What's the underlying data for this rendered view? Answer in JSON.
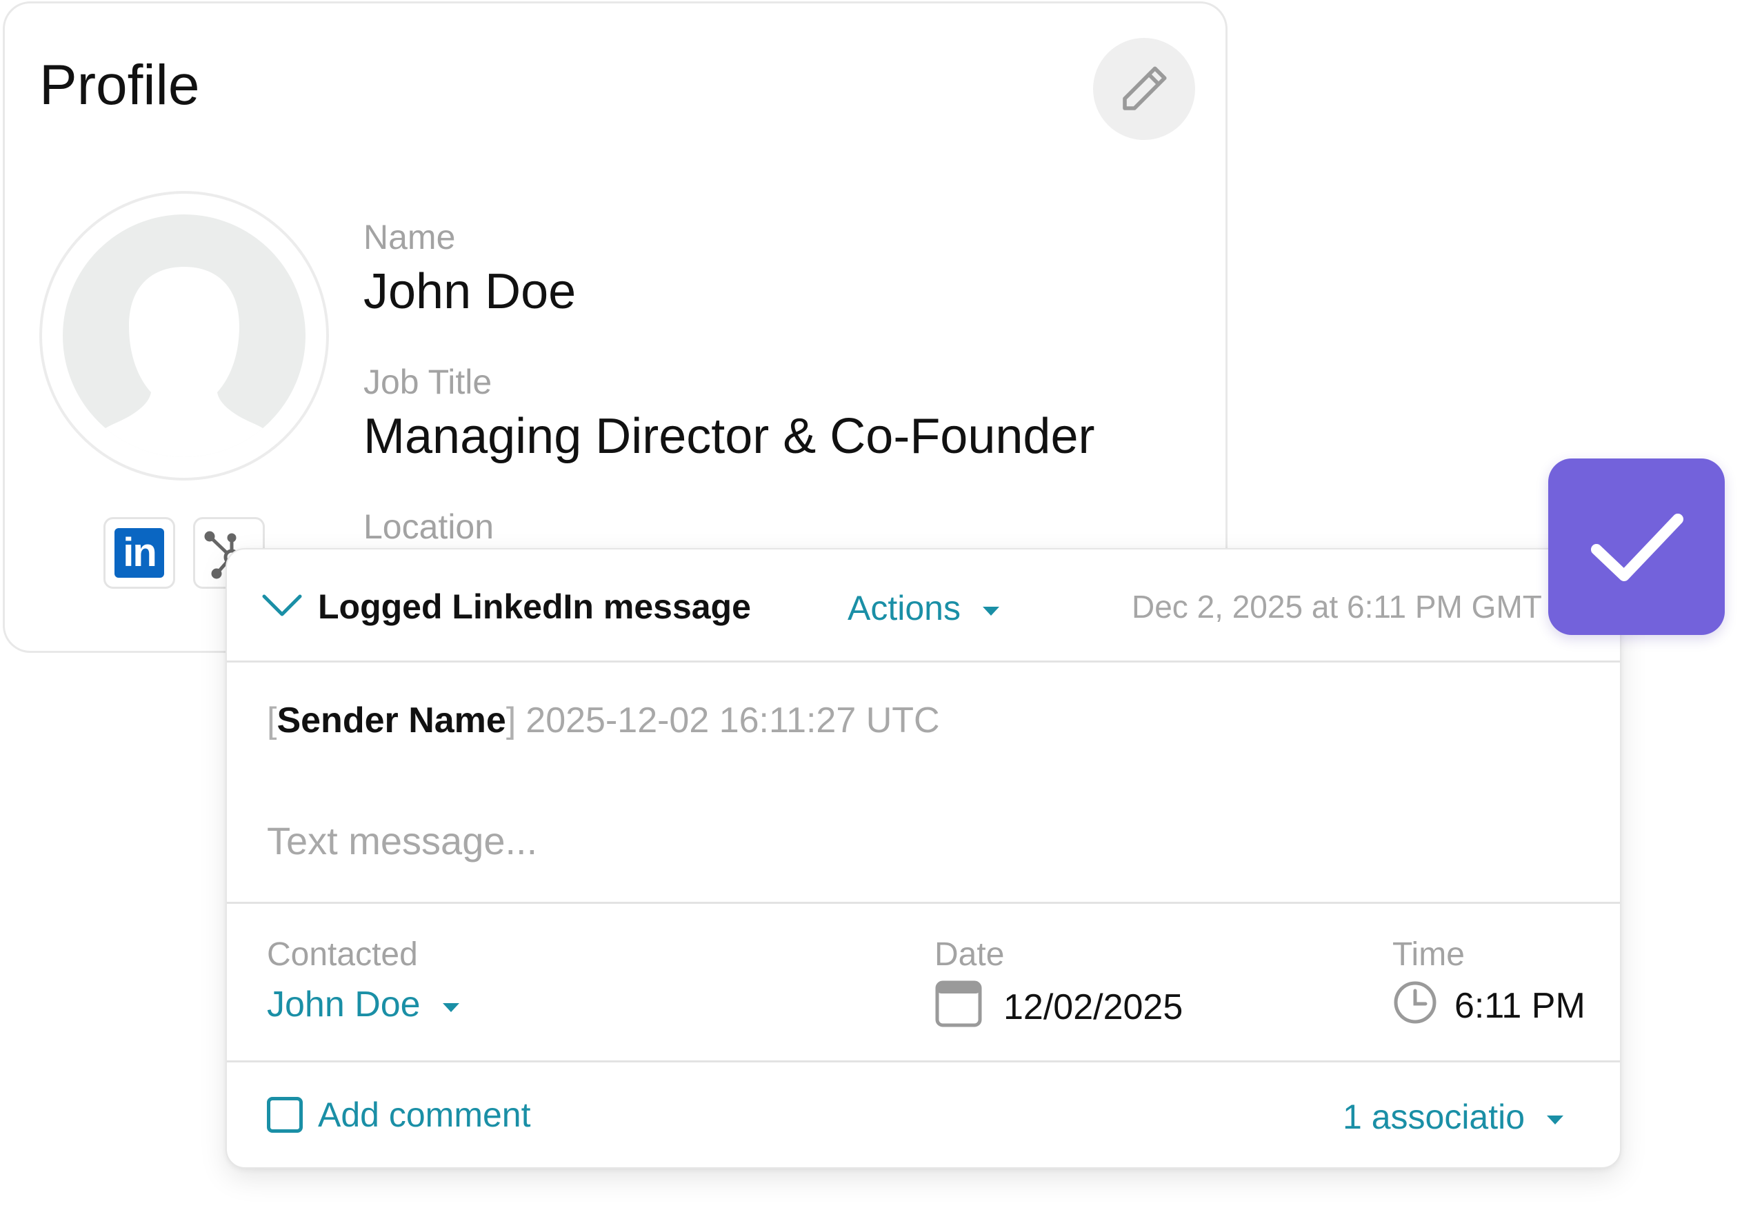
{
  "profile": {
    "title": "Profile",
    "fields": [
      {
        "label": "Name",
        "value": "John Doe"
      },
      {
        "label": "Job Title",
        "value": "Managing Director & Co-Founder"
      },
      {
        "label": "Location"
      }
    ],
    "social": {
      "linkedin_text": "in"
    }
  },
  "log": {
    "title": "Logged LinkedIn message",
    "actions_label": "Actions",
    "timestamp": "Dec 2, 2025 at 6:11 PM GMT",
    "message": {
      "open_bracket": "[",
      "sender": "Sender Name",
      "close_bracket": "]",
      "sent_at": "2025-12-02 16:11:27 UTC",
      "placeholder": "Text message..."
    },
    "meta": {
      "contacted_label": "Contacted",
      "contacted_value": "John Doe",
      "date_label": "Date",
      "date_value": "12/02/2025",
      "time_label": "Time",
      "time_value": "6:11 PM"
    },
    "footer": {
      "add_comment_label": "Add comment",
      "associations_label": "1 associatio"
    }
  },
  "colors": {
    "accent": "#1a8fa6",
    "badge": "#7362db",
    "linkedin": "#0a66c2"
  },
  "icons": [
    "pencil-icon",
    "avatar-silhouette-icon",
    "linkedin-icon",
    "hubspot-sprocket-icon",
    "chevron-down-icon",
    "caret-down-icon",
    "calendar-icon",
    "clock-icon",
    "checkmark-icon"
  ]
}
